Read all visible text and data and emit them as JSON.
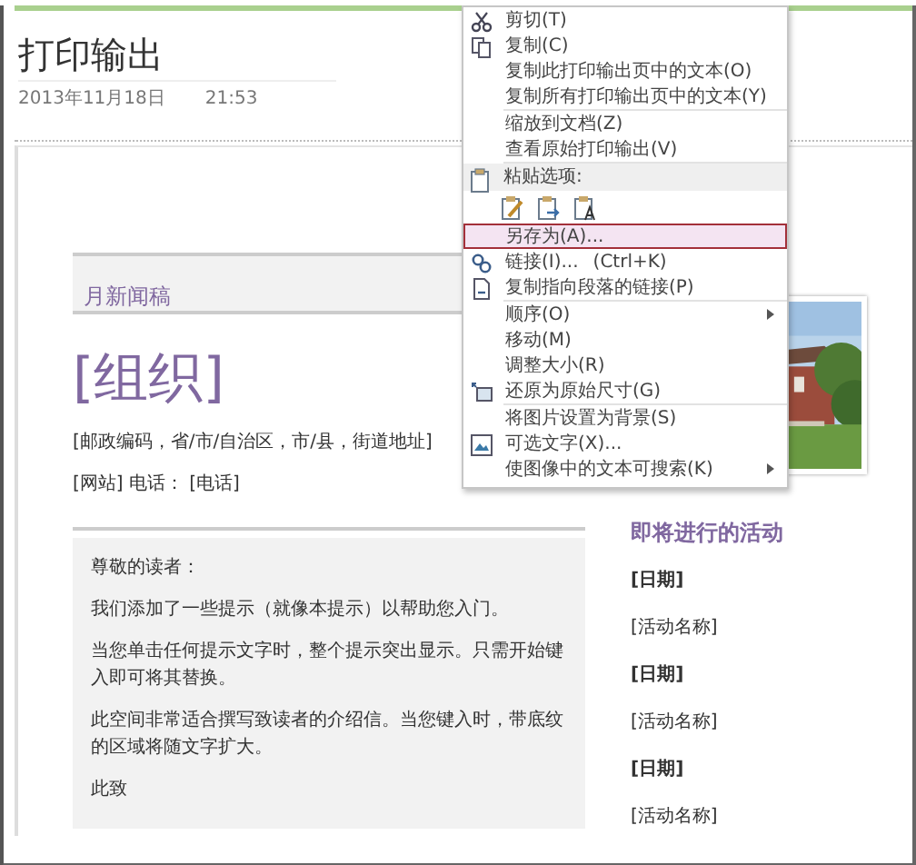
{
  "note": {
    "title": "打印输出",
    "date": "2013年11月18日",
    "time": "21:53"
  },
  "newsletter": {
    "masthead": "月新闻稿",
    "organization": "[组织]",
    "address": "[邮政编码，省/市/自治区，市/县，街道地址]",
    "contact": "[网站] 电话： [电话]",
    "letter": [
      "尊敬的读者：",
      "我们添加了一些提示（就像本提示）以帮助您入门。",
      "当您单击任何提示文字时，整个提示突出显示。只需开始键入即可将其替换。",
      "此空间非常适合撰写致读者的介绍信。当您键入时，带底纹的区域将随文字扩大。",
      "此致"
    ],
    "events": {
      "heading": "即将进行的活动",
      "items": [
        {
          "kind": "date",
          "text": "[日期]"
        },
        {
          "kind": "name",
          "text": "[活动名称]"
        },
        {
          "kind": "date",
          "text": "[日期]"
        },
        {
          "kind": "name",
          "text": "[活动名称]"
        },
        {
          "kind": "date",
          "text": "[日期]"
        },
        {
          "kind": "name",
          "text": "[活动名称]"
        }
      ]
    }
  },
  "context_menu": {
    "items": [
      {
        "kind": "item",
        "label": "剪切(T)",
        "selected": false
      },
      {
        "kind": "item",
        "label": "复制(C)",
        "selected": false
      },
      {
        "kind": "item",
        "label": "复制此打印输出页中的文本(O)",
        "selected": false
      },
      {
        "kind": "item",
        "label": "复制所有打印输出页中的文本(Y)",
        "selected": false
      },
      {
        "kind": "separator"
      },
      {
        "kind": "item",
        "label": "缩放到文档(Z)",
        "selected": false
      },
      {
        "kind": "item",
        "label": "查看原始打印输出(V)",
        "selected": false
      },
      {
        "kind": "separator"
      },
      {
        "kind": "header",
        "label": "粘贴选项:"
      },
      {
        "kind": "paste-options"
      },
      {
        "kind": "item",
        "label": "另存为(A)...",
        "selected": true
      },
      {
        "kind": "item",
        "label": "链接(I)...",
        "shortcut": "(Ctrl+K)",
        "selected": false
      },
      {
        "kind": "item",
        "label": "复制指向段落的链接(P)",
        "selected": false
      },
      {
        "kind": "separator"
      },
      {
        "kind": "item",
        "label": "顺序(O)",
        "submenu": true,
        "selected": false
      },
      {
        "kind": "item",
        "label": "移动(M)",
        "selected": false
      },
      {
        "kind": "item",
        "label": "调整大小(R)",
        "selected": false
      },
      {
        "kind": "item",
        "label": "还原为原始尺寸(G)",
        "selected": false
      },
      {
        "kind": "separator"
      },
      {
        "kind": "item",
        "label": "将图片设置为背景(S)",
        "selected": false
      },
      {
        "kind": "item",
        "label": "可选文字(X)...",
        "selected": false
      },
      {
        "kind": "item",
        "label": "使图像中的文本可搜索(K)",
        "submenu": true,
        "selected": false
      }
    ]
  }
}
